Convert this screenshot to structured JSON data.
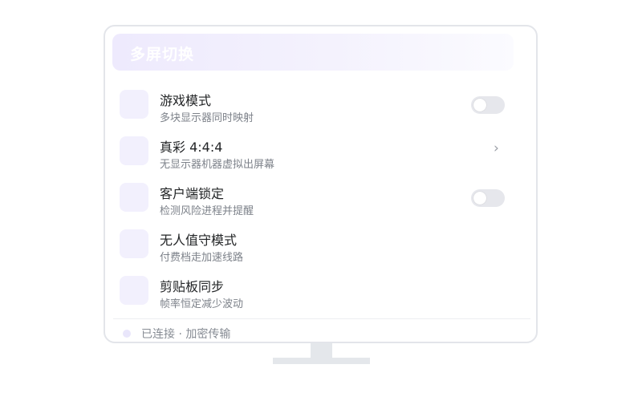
{
  "header": {
    "title": "多屏切换"
  },
  "items": [
    {
      "title": "游戏模式",
      "subtitle": "多块显示器同时映射",
      "control": "toggle",
      "on": false
    },
    {
      "title": "真彩 4:4:4",
      "subtitle": "无显示器机器虚拟出屏幕",
      "control": "chevron",
      "chevron": "›"
    },
    {
      "title": "客户端锁定",
      "subtitle": "检测风险进程并提醒",
      "control": "toggle",
      "on": false
    },
    {
      "title": "无人值守模式",
      "subtitle": "付费档走加速线路",
      "control": "none"
    },
    {
      "title": "剪贴板同步",
      "subtitle": "帧率恒定减少波动",
      "control": "none"
    }
  ],
  "status": {
    "text": "已连接 · 加密传输"
  },
  "colors": {
    "accent_soft": "#f2f0fd",
    "toggle_off": "#e6e7ec",
    "frame": "#e3e5ea"
  }
}
